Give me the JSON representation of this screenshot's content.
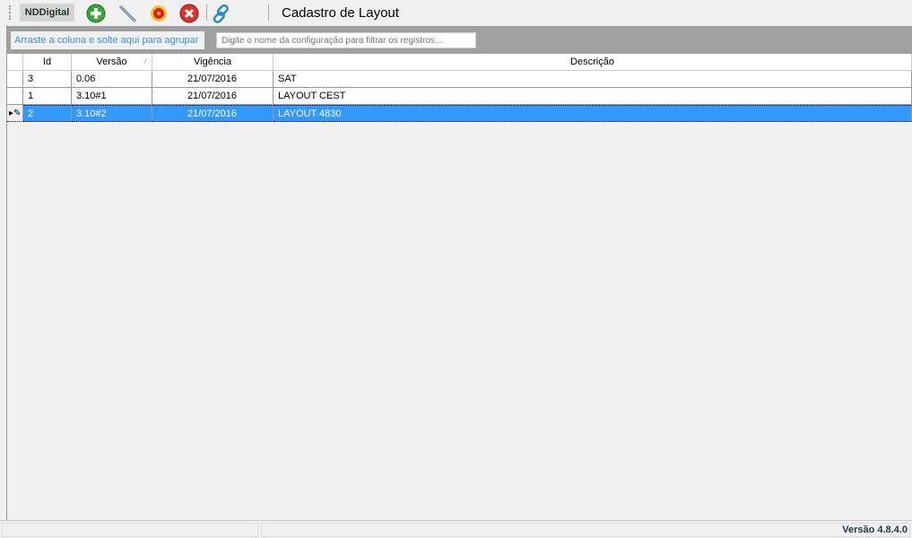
{
  "toolbar": {
    "brand": "NDDigital",
    "title": "Cadastro de Layout",
    "icons": [
      "add-icon",
      "edit-pencil-icon",
      "settings-gear-icon",
      "delete-icon",
      "link-icon"
    ]
  },
  "groupbar": {
    "hint": "Arraste a coluna e solte aqui para agrupar",
    "filter_placeholder": "Digite o nome da configuração para filtrar os registros..."
  },
  "grid": {
    "columns": [
      "Id",
      "Versão",
      "Vigência",
      "Descrição"
    ],
    "rows": [
      {
        "id": "3",
        "versao": "0.06",
        "vigencia": "21/07/2016",
        "descricao": "SAT"
      },
      {
        "id": "1",
        "versao": "3.10#1",
        "vigencia": "21/07/2016",
        "descricao": "LAYOUT CEST"
      },
      {
        "id": "2",
        "versao": "3.10#2",
        "vigencia": "21/07/2016",
        "descricao": "LAYOUT 4830"
      }
    ]
  },
  "status": {
    "version": "Versão 4.8.4.0"
  },
  "colors": {
    "selection": "#3399ff",
    "hint": "#3c8fe8"
  }
}
